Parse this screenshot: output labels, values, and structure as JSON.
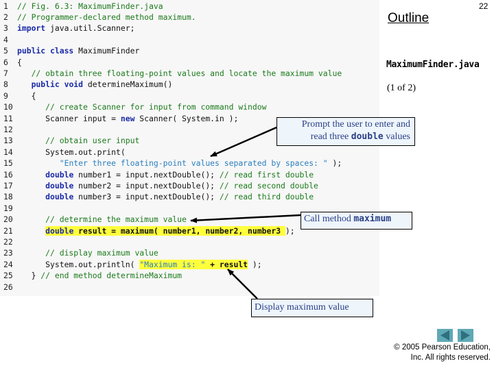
{
  "slide": {
    "number": "22",
    "outline_label": "Outline",
    "file_name": "MaximumFinder.java",
    "page_indicator": "(1 of 2)"
  },
  "code": {
    "lines": [
      {
        "n": "1",
        "segments": [
          {
            "t": "// Fig. 6.3: MaximumFinder.java",
            "c": "cm"
          }
        ]
      },
      {
        "n": "2",
        "segments": [
          {
            "t": "// Programmer-declared method maximum.",
            "c": "cm"
          }
        ]
      },
      {
        "n": "3",
        "segments": [
          {
            "t": "import",
            "c": "kw"
          },
          {
            "t": " java.util.Scanner;",
            "c": ""
          }
        ]
      },
      {
        "n": "4",
        "segments": []
      },
      {
        "n": "5",
        "segments": [
          {
            "t": "public class",
            "c": "kw"
          },
          {
            "t": " MaximumFinder",
            "c": ""
          }
        ]
      },
      {
        "n": "6",
        "segments": [
          {
            "t": "{",
            "c": ""
          }
        ]
      },
      {
        "n": "7",
        "segments": [
          {
            "t": "   // obtain three floating-point values and locate the maximum value",
            "c": "cm"
          }
        ]
      },
      {
        "n": "8",
        "segments": [
          {
            "t": "   ",
            "c": ""
          },
          {
            "t": "public void",
            "c": "kw"
          },
          {
            "t": " determineMaximum()",
            "c": ""
          }
        ]
      },
      {
        "n": "9",
        "segments": [
          {
            "t": "   {",
            "c": ""
          }
        ]
      },
      {
        "n": "10",
        "segments": [
          {
            "t": "      // create Scanner for input from command window",
            "c": "cm"
          }
        ]
      },
      {
        "n": "11",
        "segments": [
          {
            "t": "      Scanner input = ",
            "c": ""
          },
          {
            "t": "new",
            "c": "kw"
          },
          {
            "t": " Scanner( System.in );",
            "c": ""
          }
        ]
      },
      {
        "n": "12",
        "segments": []
      },
      {
        "n": "13",
        "segments": [
          {
            "t": "      // obtain user input",
            "c": "cm"
          }
        ]
      },
      {
        "n": "14",
        "segments": [
          {
            "t": "      System.out.print(",
            "c": ""
          }
        ]
      },
      {
        "n": "15",
        "segments": [
          {
            "t": "         ",
            "c": ""
          },
          {
            "t": "\"Enter three floating-point values separated by spaces: \"",
            "c": "st"
          },
          {
            "t": " );",
            "c": ""
          }
        ]
      },
      {
        "n": "16",
        "segments": [
          {
            "t": "      ",
            "c": ""
          },
          {
            "t": "double",
            "c": "kw"
          },
          {
            "t": " number1 = input.nextDouble(); ",
            "c": ""
          },
          {
            "t": "// read first double",
            "c": "cm"
          }
        ]
      },
      {
        "n": "17",
        "segments": [
          {
            "t": "      ",
            "c": ""
          },
          {
            "t": "double",
            "c": "kw"
          },
          {
            "t": " number2 = input.nextDouble(); ",
            "c": ""
          },
          {
            "t": "// read second double",
            "c": "cm"
          }
        ]
      },
      {
        "n": "18",
        "segments": [
          {
            "t": "      ",
            "c": ""
          },
          {
            "t": "double",
            "c": "kw"
          },
          {
            "t": " number3 = input.nextDouble(); ",
            "c": ""
          },
          {
            "t": "// read third double",
            "c": "cm"
          }
        ]
      },
      {
        "n": "19",
        "segments": []
      },
      {
        "n": "20",
        "segments": [
          {
            "t": "      // determine the maximum value",
            "c": "cm"
          }
        ]
      },
      {
        "n": "21",
        "segments": [
          {
            "t": "      ",
            "c": ""
          },
          {
            "t": "double",
            "c": "kw hl"
          },
          {
            "t": " result = maximum( number1, number2, number3 ",
            "c": "bd hl"
          },
          {
            "t": ");",
            "c": ""
          }
        ]
      },
      {
        "n": "22",
        "segments": []
      },
      {
        "n": "23",
        "segments": [
          {
            "t": "      // display maximum value",
            "c": "cm"
          }
        ]
      },
      {
        "n": "24",
        "segments": [
          {
            "t": "      System.out.println( ",
            "c": ""
          },
          {
            "t": "\"Maximum is: \"",
            "c": "st hl"
          },
          {
            "t": " + result",
            "c": "bd hl"
          },
          {
            "t": " );",
            "c": ""
          }
        ]
      },
      {
        "n": "25",
        "segments": [
          {
            "t": "   } ",
            "c": ""
          },
          {
            "t": "// end method determineMaximum",
            "c": "cm"
          }
        ]
      },
      {
        "n": "26",
        "segments": []
      }
    ]
  },
  "callouts": {
    "prompt": {
      "line1": "Prompt the user to enter and",
      "line2_pre": "read three ",
      "line2_code": "double",
      "line2_post": " values"
    },
    "call": {
      "pre": "Call method ",
      "code": "maximum"
    },
    "display": {
      "text": "Display maximum value"
    }
  },
  "navigation": {
    "prev_icon": "left-triangle",
    "next_icon": "right-triangle"
  },
  "footer": {
    "copyright_line1": "© 2005 Pearson Education,",
    "copyright_line2": "Inc.  All rights reserved."
  },
  "colors": {
    "comment": "#1c7a1c",
    "keyword": "#1a2aa6",
    "string": "#2a7fbf",
    "highlight": "#ffff3c",
    "callout_bg": "#eef5fb",
    "callout_text": "#2b3f86",
    "nav_button": "#5fa9b5"
  }
}
